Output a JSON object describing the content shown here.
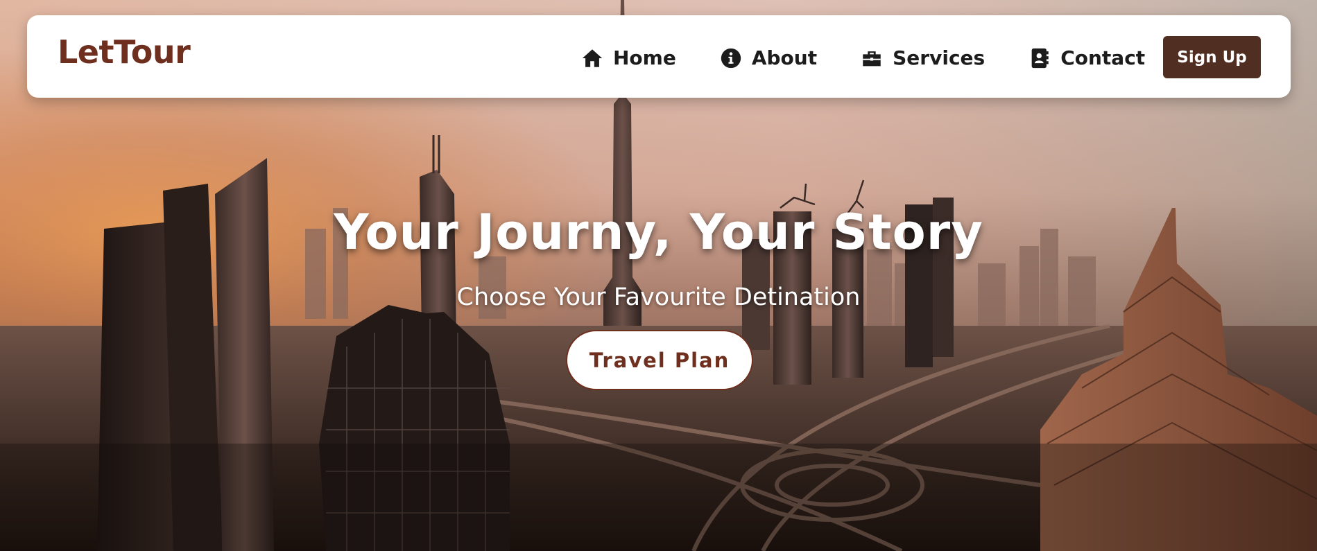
{
  "brand": {
    "name": "LetTour",
    "color": "#6e2f1f"
  },
  "nav": {
    "items": [
      {
        "label": "Home",
        "icon": "home-icon"
      },
      {
        "label": "About",
        "icon": "info-icon"
      },
      {
        "label": "Services",
        "icon": "briefcase-icon"
      },
      {
        "label": "Contact",
        "icon": "contact-book-icon"
      }
    ],
    "signup_label": "Sign Up",
    "signup_color": "#512e22"
  },
  "hero": {
    "title": "Your Journy, Your Story",
    "subtitle": "Choose Your Favourite Detination",
    "cta_label": "Travel Plan",
    "background": "city-skyline-sunset-image"
  }
}
